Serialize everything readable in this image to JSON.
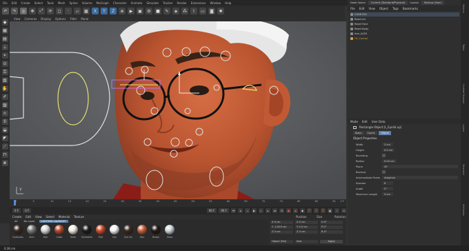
{
  "menubar": {
    "items": [
      "File",
      "Edit",
      "Create",
      "Select",
      "Tools",
      "Mesh",
      "Spline",
      "Volume",
      "MoGraph",
      "Character",
      "Animate",
      "Simulate",
      "Tracker",
      "Render",
      "Extensions",
      "Window",
      "Help"
    ],
    "node_space_label": "Node Space:",
    "node_space_value": "Current (Standard/Physical)",
    "layout_label": "Layout:",
    "layout_value": "Startup (User)"
  },
  "viewport_menu": [
    "View",
    "Cameras",
    "Display",
    "Options",
    "Filter",
    "Panel"
  ],
  "axis_label": "Y",
  "timeline": {
    "ticks": [
      "0",
      "5",
      "10",
      "15",
      "20",
      "25",
      "30",
      "35",
      "40",
      "45",
      "50",
      "55",
      "60",
      "65",
      "70",
      "75",
      "80",
      "85",
      "90"
    ],
    "end_label": "0 F",
    "fields": [
      "0 F",
      "0 F",
      "90 F",
      "90 F"
    ]
  },
  "material_menu": [
    "Create",
    "Edit",
    "View",
    "Select",
    "Material",
    "Texture"
  ],
  "material_filters": [
    "All",
    "No Layer",
    "LIGHTING Lib/RIGHT"
  ],
  "materials": [
    {
      "name": "Eyebrows",
      "color": "#3a2a22"
    },
    {
      "name": "Shirt",
      "color": "#7a7a7a"
    },
    {
      "name": "Hair",
      "color": "#dadada"
    },
    {
      "name": "Collar",
      "color": "#b8492e"
    },
    {
      "name": "Teeth",
      "color": "#f1ece3"
    },
    {
      "name": "Eyelashes",
      "color": "#1c1c1c"
    },
    {
      "name": "Mat",
      "color": "#d24b2d"
    },
    {
      "name": "Eye",
      "color": "#f5f5f5"
    },
    {
      "name": "Eye Iris",
      "color": "#3b2920"
    },
    {
      "name": "Skin",
      "color": "#c9633b"
    },
    {
      "name": "Brows",
      "color": "#221a16"
    },
    {
      "name": "Glass",
      "color": "#cfd6db"
    }
  ],
  "coords": {
    "headers": [
      "Position",
      "Size",
      "Rotation"
    ],
    "rows": [
      [
        "X  0 cm",
        "X  0 cm",
        "H  0°"
      ],
      [
        "Y  -2.819 cm",
        "Y  0.5 cm",
        "P  0°"
      ],
      [
        "Z  0 cm",
        "Z  0 cm",
        "B  0°"
      ]
    ],
    "mode1": "Object (Rel)",
    "mode2": "Size",
    "apply_label": "Apply"
  },
  "status_text": "0.36 cm",
  "object_manager": {
    "menu": [
      "File",
      "Edit",
      "View",
      "Object",
      "Tags",
      "Bookmarks"
    ],
    "items": [
      {
        "name": "CHAR RIG",
        "color": "#7a8c9e"
      },
      {
        "name": "Reset Arr",
        "color": "#8a8a8a"
      },
      {
        "name": "Reset Face",
        "color": "#8a8a8a"
      },
      {
        "name": "Reset Body",
        "color": "#8a8a8a"
      },
      {
        "name": "Arm_IK/FK",
        "color": "#8a8a8a"
      },
      {
        "name": "FK_Control",
        "color": "#d0a040"
      }
    ]
  },
  "attributes": {
    "menu": [
      "Mode",
      "Edit",
      "User Data"
    ],
    "title": "Rectangle Object [L_Eyelid up]",
    "tabs": [
      "Basic",
      "Coord.",
      "Object"
    ],
    "active_tab": "Object",
    "section": "Object Properties",
    "props": [
      {
        "label": "Width",
        "value": "3 cm"
      },
      {
        "label": "Height",
        "value": "0.5 cm"
      },
      {
        "label": "Rounding",
        "value": ""
      },
      {
        "label": "Radius",
        "value": "0.05 cm"
      },
      {
        "label": "Plane",
        "value": "XY"
      },
      {
        "label": "Reverse",
        "value": ""
      },
      {
        "label": "Intermediate Points",
        "value": "Adaptive"
      },
      {
        "label": "Number",
        "value": "8"
      },
      {
        "label": "Angle",
        "value": "5°"
      },
      {
        "label": "Maximum Length",
        "value": "5 cm"
      }
    ]
  },
  "side_tabs": [
    "Objects",
    "Takes",
    "Content Browser",
    "Layers",
    "Structure",
    "Attributes"
  ],
  "colors": {
    "accent": "#3b6a9e",
    "skin": "#c9633b",
    "hair": "#e6e6e6",
    "spline": "#e8e070"
  }
}
